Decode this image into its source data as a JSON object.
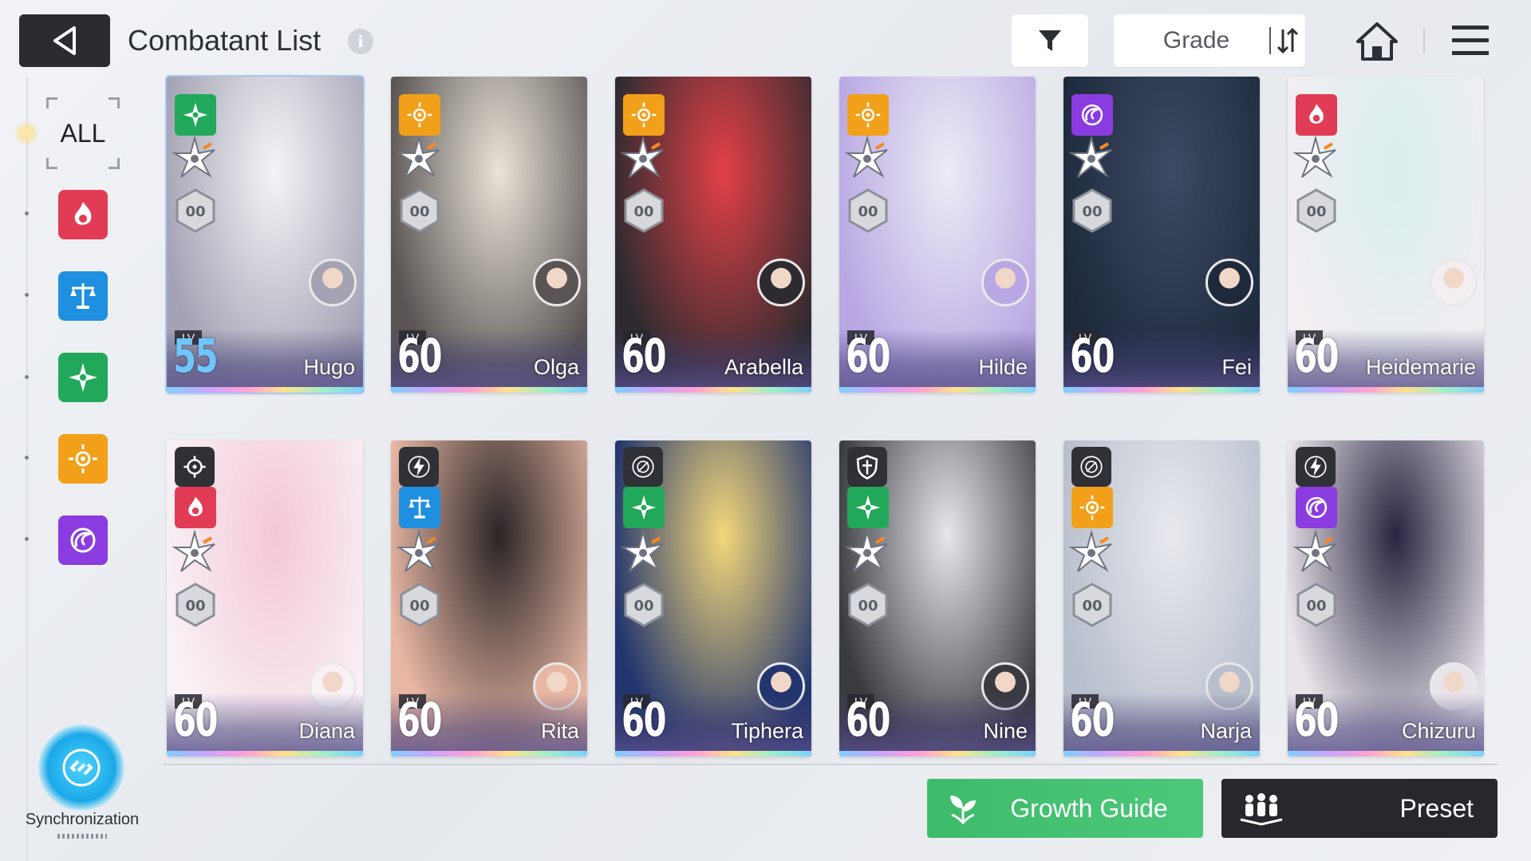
{
  "header": {
    "title": "Combatant List",
    "info_glyph": "i",
    "sort_label": "Grade"
  },
  "sidebar": {
    "all_label": "ALL",
    "elements": [
      {
        "name": "fire",
        "color": "#e23b55"
      },
      {
        "name": "order",
        "color": "#1f8fe0"
      },
      {
        "name": "wind",
        "color": "#22a85a"
      },
      {
        "name": "light",
        "color": "#f2a01a"
      },
      {
        "name": "void",
        "color": "#8a3ce0"
      }
    ],
    "sync_label": "Synchronization"
  },
  "cards": [
    {
      "name": "Hugo",
      "lv_tag": "LV",
      "level": "55",
      "grade": "00",
      "element": "wind",
      "selected": true,
      "bg": [
        "#f4f4f7",
        "#a3a3b4"
      ]
    },
    {
      "name": "Olga",
      "lv_tag": "LV",
      "level": "60",
      "grade": "00",
      "element": "light",
      "selected": false,
      "bg": [
        "#e9e3d8",
        "#5a5554"
      ]
    },
    {
      "name": "Arabella",
      "lv_tag": "LV",
      "level": "60",
      "grade": "00",
      "element": "light",
      "selected": false,
      "bg": [
        "#e24046",
        "#2d2b30"
      ]
    },
    {
      "name": "Hilde",
      "lv_tag": "LV",
      "level": "60",
      "grade": "00",
      "element": "light",
      "selected": false,
      "bg": [
        "#ecebf5",
        "#b9a8e3"
      ]
    },
    {
      "name": "Fei",
      "lv_tag": "LV",
      "level": "60",
      "grade": "00",
      "element": "void",
      "selected": false,
      "bg": [
        "#3d4a64",
        "#1e2a3c"
      ]
    },
    {
      "name": "Heidemarie",
      "lv_tag": "LV",
      "level": "60",
      "grade": "00",
      "element": "fire",
      "selected": false,
      "bg": [
        "#d9efee",
        "#f2eef2"
      ]
    },
    {
      "name": "Diana",
      "lv_tag": "LV",
      "level": "60",
      "grade": "00",
      "element": "fire",
      "type": "target",
      "selected": false,
      "bg": [
        "#f5c7d8",
        "#f8f1f5"
      ]
    },
    {
      "name": "Rita",
      "lv_tag": "LV",
      "level": "60",
      "grade": "00",
      "element": "order",
      "type": "bolt",
      "selected": false,
      "bg": [
        "#2a2527",
        "#e8b7a3"
      ]
    },
    {
      "name": "Tiphera",
      "lv_tag": "LV",
      "level": "60",
      "grade": "00",
      "element": "wind",
      "type": "reticle",
      "selected": false,
      "bg": [
        "#f3d77a",
        "#22356e"
      ]
    },
    {
      "name": "Nine",
      "lv_tag": "LV",
      "level": "60",
      "grade": "00",
      "element": "wind",
      "type": "shield",
      "selected": false,
      "bg": [
        "#e6e7ea",
        "#3a3b40"
      ]
    },
    {
      "name": "Narja",
      "lv_tag": "LV",
      "level": "60",
      "grade": "00",
      "element": "light",
      "type": "reticle",
      "selected": false,
      "bg": [
        "#e7e9ee",
        "#b8bfcc"
      ]
    },
    {
      "name": "Chizuru",
      "lv_tag": "LV",
      "level": "60",
      "grade": "00",
      "element": "void",
      "type": "bolt",
      "selected": false,
      "bg": [
        "#2a2440",
        "#e9e4ea"
      ]
    }
  ],
  "footer": {
    "growth_label": "Growth Guide",
    "preset_label": "Preset"
  }
}
